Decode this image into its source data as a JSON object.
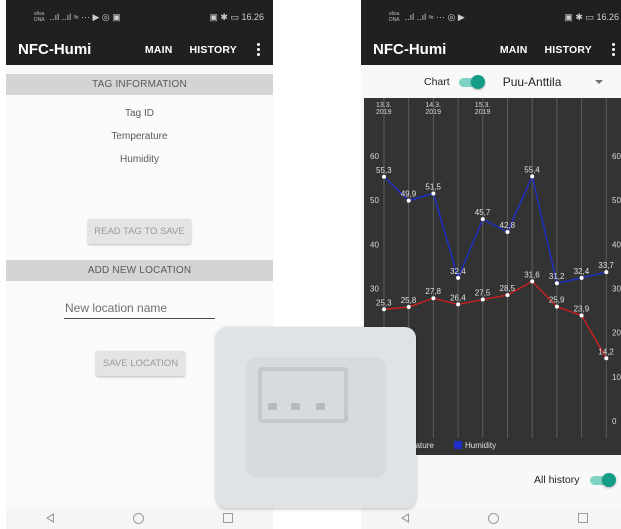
{
  "left_screen": {
    "status": {
      "carrier": "elisa\nDNA",
      "icons": "..ıl ..ıl ≈ ··· ▶ ◎ ▣",
      "right": "▣ ✱ ▭ 16.26"
    },
    "appbar": {
      "title": "NFC-Humi",
      "menu_main": "MAIN",
      "menu_history": "HISTORY"
    },
    "tag_info": {
      "header": "TAG INFORMATION",
      "tag_id": "Tag ID",
      "temperature": "Temperature",
      "humidity": "Humidity"
    },
    "read_button": "READ TAG TO SAVE",
    "new_location": {
      "header": "ADD NEW LOCATION",
      "placeholder": "New location name",
      "save_button": "SAVE LOCATION"
    }
  },
  "right_screen": {
    "status": {
      "carrier": "elisa\nDNA",
      "icons": "..ıl ..ıl ≈ ··· ◎ ▶",
      "right": "▣ ✱ ▭ 16.26"
    },
    "appbar": {
      "title": "NFC-Humi",
      "menu_main": "MAIN",
      "menu_history": "HISTORY"
    },
    "chart_toggle_label": "Chart",
    "chart_toggle_on": true,
    "location_selected": "Puu-Anttila",
    "all_history_label": "All history",
    "all_history_on": true
  },
  "chart_data": {
    "type": "line",
    "title": "",
    "x_date_labels": [
      {
        "index": 0,
        "label": "13.3.\n2019"
      },
      {
        "index": 2,
        "label": "14.3.\n2019"
      },
      {
        "index": 4,
        "label": "15.3.\n2019"
      }
    ],
    "x": [
      0,
      1,
      2,
      3,
      4,
      5,
      6,
      7,
      8,
      9,
      10
    ],
    "ylim": [
      0,
      60
    ],
    "y_ticks": [
      0,
      10,
      20,
      30,
      40,
      50,
      60
    ],
    "grid": true,
    "legend_position": "bottom",
    "series": [
      {
        "name": "Temperature",
        "color": "#cc1f1f",
        "values": [
          25.3,
          25.8,
          27.8,
          26.4,
          27.5,
          28.5,
          31.6,
          25.9,
          23.9,
          14.2,
          null
        ]
      },
      {
        "name": "Humidity",
        "color": "#1f2fcc",
        "values": [
          55.3,
          49.9,
          51.5,
          32.4,
          45.7,
          42.8,
          55.4,
          31.2,
          32.4,
          33.7,
          null
        ]
      }
    ],
    "legend_labels": {
      "temperature": "perature",
      "humidity": "Humidity"
    }
  },
  "colors": {
    "appbar": "#202020",
    "accent": "#139c86",
    "chart_bg": "#333333"
  }
}
